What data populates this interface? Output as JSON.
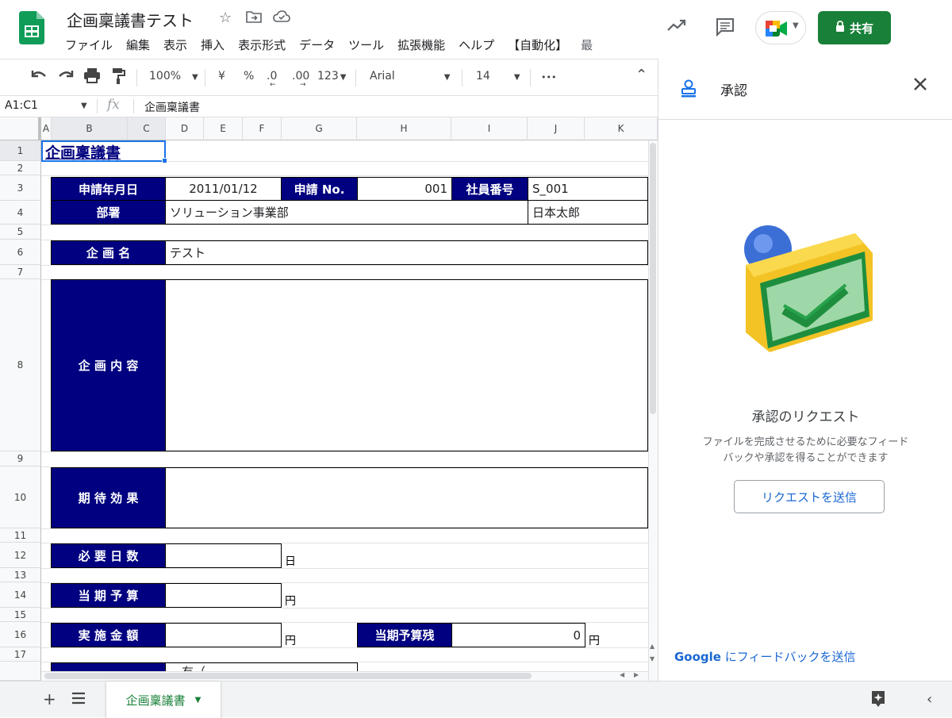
{
  "app": {
    "doc_title": "企画稟議書テスト",
    "menu": [
      "ファイル",
      "編集",
      "表示",
      "挿入",
      "表示形式",
      "データ",
      "ツール",
      "拡張機能",
      "ヘルプ",
      "【自動化】",
      "最"
    ],
    "share_label": "共有"
  },
  "toolbar": {
    "zoom": "100%",
    "currency": "¥",
    "percent": "%",
    "dec_decrease": ".0",
    "dec_increase": ".00",
    "number_format": "123",
    "font": "Arial",
    "font_size": "14",
    "more": "•••"
  },
  "formula_bar": {
    "name_box": "A1:C1",
    "fx": "fx",
    "content": "企画稟議書"
  },
  "columns": [
    "A",
    "B",
    "C",
    "D",
    "E",
    "F",
    "G",
    "H",
    "I",
    "J",
    "K"
  ],
  "rows": [
    "1",
    "2",
    "3",
    "4",
    "5",
    "6",
    "7",
    "8",
    "9",
    "10",
    "11",
    "12",
    "13",
    "14",
    "15",
    "16",
    "17"
  ],
  "sheet": {
    "title": "企画稟議書",
    "apply_date_label": "申請年月日",
    "apply_date": "2011/01/12",
    "apply_no_label": "申請 No.",
    "apply_no": "001",
    "employee_no_label": "社員番号",
    "employee_no": "S_001",
    "dept_label": "部署",
    "dept": "ソリューション事業部",
    "name": "日本太郎",
    "plan_name_label": "企 画 名",
    "plan_name": "テスト",
    "plan_content_label": "企 画 内 容",
    "effect_label": "期 待 効 果",
    "days_label": "必 要 日 数",
    "days_unit": "日",
    "budget_label": "当 期 予 算",
    "budget_unit": "円",
    "amount_label": "実 施 金 額",
    "amount_unit": "円",
    "remain_label": "当期予算残",
    "remain_value": "0",
    "remain_unit": "円",
    "row18_partial": "有（"
  },
  "panel": {
    "title": "承認",
    "heading": "承認のリクエスト",
    "desc_line1": "ファイルを完成させるために必要なフィード",
    "desc_line2": "バックや承認を得ることができます",
    "request_button": "リクエストを送信",
    "feedback_brand": "Google",
    "feedback_text": " にフィードバックを送信"
  },
  "bottom": {
    "sheet_tab": "企画稟議書"
  },
  "colors": {
    "navy": "#000080",
    "share_green": "#188038",
    "link_blue": "#1967d2",
    "sheets_green": "#0f9d58"
  }
}
